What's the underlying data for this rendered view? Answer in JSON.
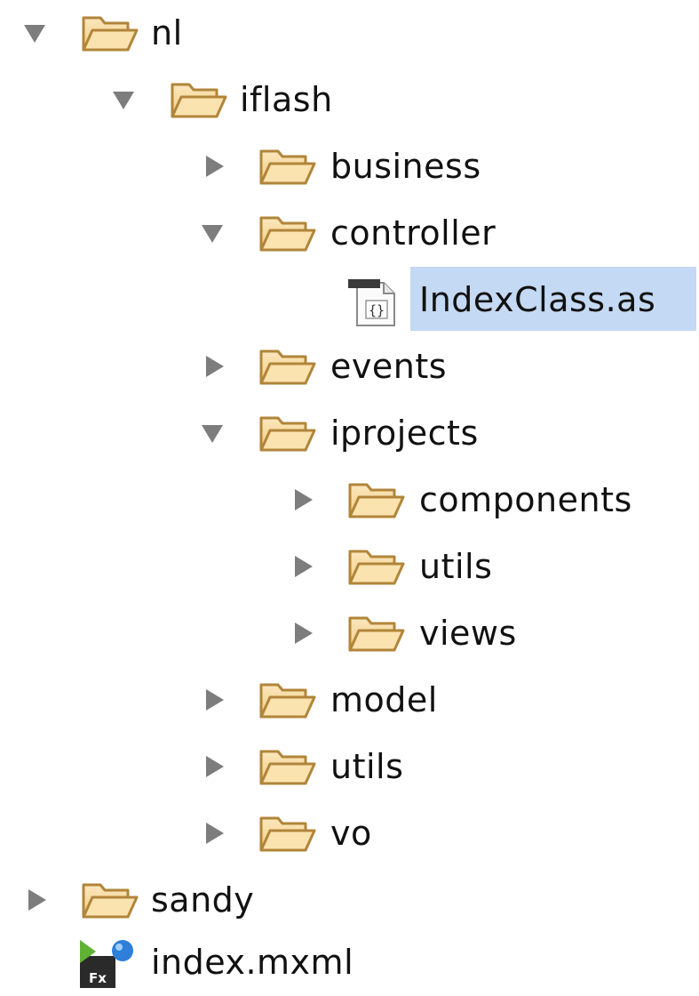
{
  "tree": {
    "items": [
      {
        "label": "nl",
        "type": "folder",
        "state": "expanded"
      },
      {
        "label": "iflash",
        "type": "folder",
        "state": "expanded"
      },
      {
        "label": "business",
        "type": "folder",
        "state": "collapsed"
      },
      {
        "label": "controller",
        "type": "folder",
        "state": "expanded"
      },
      {
        "label": "IndexClass.as",
        "type": "actionscript-file",
        "selected": true
      },
      {
        "label": "events",
        "type": "folder",
        "state": "collapsed"
      },
      {
        "label": "iprojects",
        "type": "folder",
        "state": "expanded"
      },
      {
        "label": "components",
        "type": "folder",
        "state": "collapsed"
      },
      {
        "label": "utils",
        "type": "folder",
        "state": "collapsed"
      },
      {
        "label": "views",
        "type": "folder",
        "state": "collapsed"
      },
      {
        "label": "model",
        "type": "folder",
        "state": "collapsed"
      },
      {
        "label": "utils",
        "type": "folder",
        "state": "collapsed"
      },
      {
        "label": "vo",
        "type": "folder",
        "state": "collapsed"
      },
      {
        "label": "sandy",
        "type": "folder",
        "state": "collapsed"
      },
      {
        "label": "index.mxml",
        "type": "mxml-file"
      }
    ]
  },
  "colors": {
    "selection": "#c4d9f3",
    "folder_fill": "#f6d9a0",
    "folder_stroke": "#b58a3c",
    "twisty": "#7a7a7a"
  }
}
